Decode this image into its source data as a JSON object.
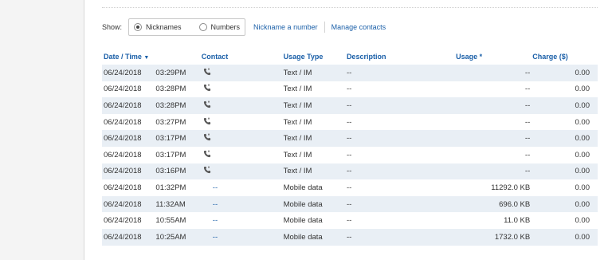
{
  "filters": {
    "show_label": "Show:",
    "options": [
      {
        "label": "Nicknames",
        "selected": true
      },
      {
        "label": "Numbers",
        "selected": false
      }
    ],
    "links": [
      "Nickname a number",
      "Manage contacts"
    ]
  },
  "table": {
    "headers": {
      "date_time": "Date / Time",
      "contact": "Contact",
      "usage_type": "Usage Type",
      "description": "Description",
      "usage": "Usage *",
      "charge": "Charge ($)"
    },
    "rows": [
      {
        "date": "06/24/2018",
        "time": "03:29PM",
        "contact_icon": "phone-icon",
        "usage_type": "Text / IM",
        "description": "--",
        "usage": "--",
        "charge": "0.00"
      },
      {
        "date": "06/24/2018",
        "time": "03:28PM",
        "contact_icon": "phone-icon",
        "usage_type": "Text / IM",
        "description": "--",
        "usage": "--",
        "charge": "0.00"
      },
      {
        "date": "06/24/2018",
        "time": "03:28PM",
        "contact_icon": "phone-icon",
        "usage_type": "Text / IM",
        "description": "--",
        "usage": "--",
        "charge": "0.00"
      },
      {
        "date": "06/24/2018",
        "time": "03:27PM",
        "contact_icon": "phone-icon",
        "usage_type": "Text / IM",
        "description": "--",
        "usage": "--",
        "charge": "0.00"
      },
      {
        "date": "06/24/2018",
        "time": "03:17PM",
        "contact_icon": "phone-icon",
        "usage_type": "Text / IM",
        "description": "--",
        "usage": "--",
        "charge": "0.00"
      },
      {
        "date": "06/24/2018",
        "time": "03:17PM",
        "contact_icon": "phone-icon",
        "usage_type": "Text / IM",
        "description": "--",
        "usage": "--",
        "charge": "0.00"
      },
      {
        "date": "06/24/2018",
        "time": "03:16PM",
        "contact_icon": "phone-icon",
        "usage_type": "Text / IM",
        "description": "--",
        "usage": "--",
        "charge": "0.00"
      },
      {
        "date": "06/24/2018",
        "time": "01:32PM",
        "contact": "--",
        "usage_type": "Mobile data",
        "description": "--",
        "usage": "11292.0 KB",
        "charge": "0.00"
      },
      {
        "date": "06/24/2018",
        "time": "11:32AM",
        "contact": "--",
        "usage_type": "Mobile data",
        "description": "--",
        "usage": "696.0 KB",
        "charge": "0.00"
      },
      {
        "date": "06/24/2018",
        "time": "10:55AM",
        "contact": "--",
        "usage_type": "Mobile data",
        "description": "--",
        "usage": "11.0 KB",
        "charge": "0.00"
      },
      {
        "date": "06/24/2018",
        "time": "10:25AM",
        "contact": "--",
        "usage_type": "Mobile data",
        "description": "--",
        "usage": "1732.0 KB",
        "charge": "0.00"
      }
    ]
  },
  "colors": {
    "link": "#1a5fa8",
    "row_alt": "#e9eff5",
    "icon": "#555555"
  }
}
